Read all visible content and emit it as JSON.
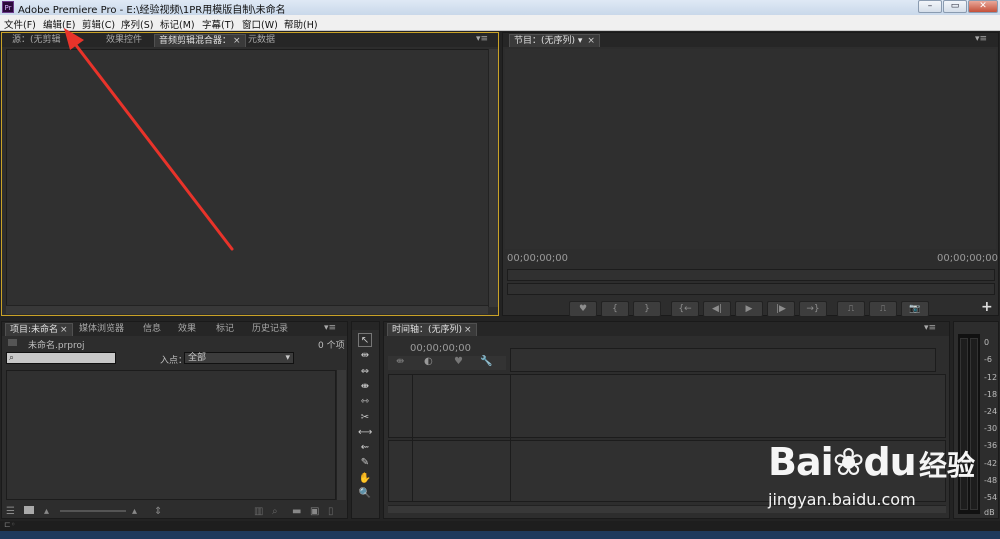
{
  "titlebar": {
    "app_icon": "Pr",
    "title": "Adobe Premiere Pro - E:\\经验视频\\1PR用模版自制\\未命名",
    "min": "–",
    "max": "▭",
    "close": "✕"
  },
  "menu": [
    "文件(F)",
    "编辑(E)",
    "剪辑(C)",
    "序列(S)",
    "标记(M)",
    "字幕(T)",
    "窗口(W)",
    "帮助(H)"
  ],
  "source_panel": {
    "tabs": [
      "源：(无剪辑",
      "效果控件",
      "音频剪辑混合器：",
      "元数据"
    ],
    "close_mark": "×",
    "menu_icon": "▾≡"
  },
  "program_panel": {
    "tab": "节目：(无序列)",
    "tab_dropdown": "▾",
    "close_mark": "×",
    "menu_icon": "▾≡",
    "timecode_left": "00;00;00;00",
    "timecode_right": "00;00;00;00",
    "add_button": "+",
    "controls": [
      "♥",
      "{",
      "}",
      "{←",
      "◀|",
      "▶",
      "|▶",
      "→}",
      "⎍",
      "⎍",
      "📷"
    ]
  },
  "project_panel": {
    "tabs": [
      "项目:未命名",
      "媒体浏览器",
      "信息",
      "效果",
      "标记",
      "历史记录"
    ],
    "close_mark": "×",
    "menu_icon": "▾≡",
    "project_file": "未命名.prproj",
    "item_count": "0 个项",
    "search_icon": "⌕",
    "in_point_label": "入点：",
    "in_point_value": "全部"
  },
  "tools": [
    "↖",
    "⇹",
    "⇔",
    "⇼",
    "⇿",
    "✂",
    "⟷",
    "⇜",
    "✎",
    "✋",
    "🔍"
  ],
  "timeline_panel": {
    "tab": "时间轴：(无序列)",
    "close_mark": "×",
    "menu_icon": "▾≡",
    "timecode": "00;00;00;00"
  },
  "meter": {
    "labels": [
      "0",
      "-6",
      "-12",
      "-18",
      "-24",
      "-30",
      "-36",
      "-42",
      "-48",
      "-54",
      "dB"
    ]
  },
  "watermark": {
    "brand": "Bai",
    "brand2": "du",
    "cn": "经验",
    "url": "jingyan.baidu.com"
  },
  "colors": {
    "accent_border": "#c9a227",
    "arrow": "#e8332a"
  }
}
